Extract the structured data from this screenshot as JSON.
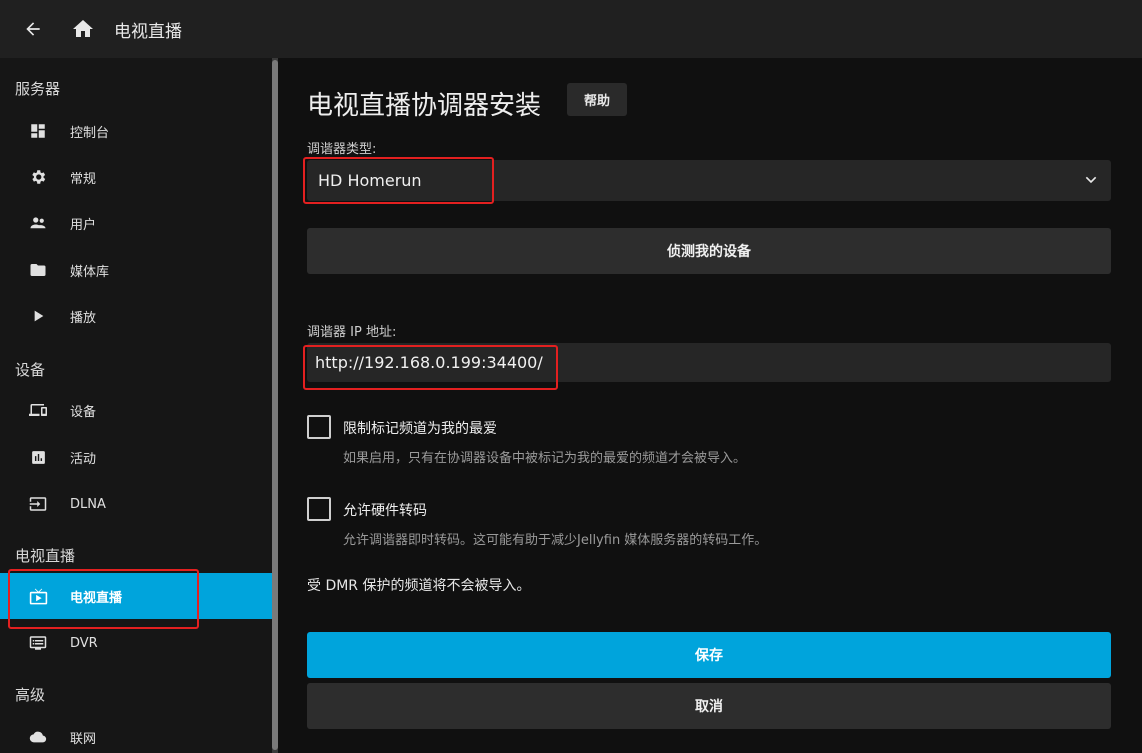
{
  "header": {
    "title": "电视直播"
  },
  "sidebar": {
    "sections": [
      {
        "title": "服务器",
        "items": [
          {
            "label": "控制台",
            "icon": "dashboard-icon"
          },
          {
            "label": "常规",
            "icon": "gear-icon"
          },
          {
            "label": "用户",
            "icon": "users-icon"
          },
          {
            "label": "媒体库",
            "icon": "folder-icon"
          },
          {
            "label": "播放",
            "icon": "play-icon"
          }
        ]
      },
      {
        "title": "设备",
        "items": [
          {
            "label": "设备",
            "icon": "devices-icon"
          },
          {
            "label": "活动",
            "icon": "activity-icon"
          },
          {
            "label": "DLNA",
            "icon": "input-icon"
          }
        ]
      },
      {
        "title": "电视直播",
        "items": [
          {
            "label": "电视直播",
            "icon": "live-tv-icon",
            "active": true
          },
          {
            "label": "DVR",
            "icon": "dvr-icon"
          }
        ]
      },
      {
        "title": "高级",
        "items": [
          {
            "label": "联网",
            "icon": "cloud-icon"
          }
        ]
      }
    ]
  },
  "main": {
    "title": "电视直播协调器安装",
    "help_label": "帮助",
    "tuner_type_label": "调谐器类型:",
    "tuner_type_value": "HD Homerun",
    "detect_button": "侦测我的设备",
    "ip_label": "调谐器 IP 地址:",
    "ip_value": "http://192.168.0.199:34400/",
    "favorites_label": "限制标记频道为我的最爱",
    "favorites_desc": "如果启用，只有在协调器设备中被标记为我的最爱的频道才会被导入。",
    "hw_transcode_label": "允许硬件转码",
    "hw_transcode_desc": "允许调谐器即时转码。这可能有助于减少Jellyfin 媒体服务器的转码工作。",
    "dmr_note": "受 DMR 保护的频道将不会被导入。",
    "save_button": "保存",
    "cancel_button": "取消"
  },
  "colors": {
    "accent": "#00a4dc",
    "highlight": "#e32020"
  }
}
